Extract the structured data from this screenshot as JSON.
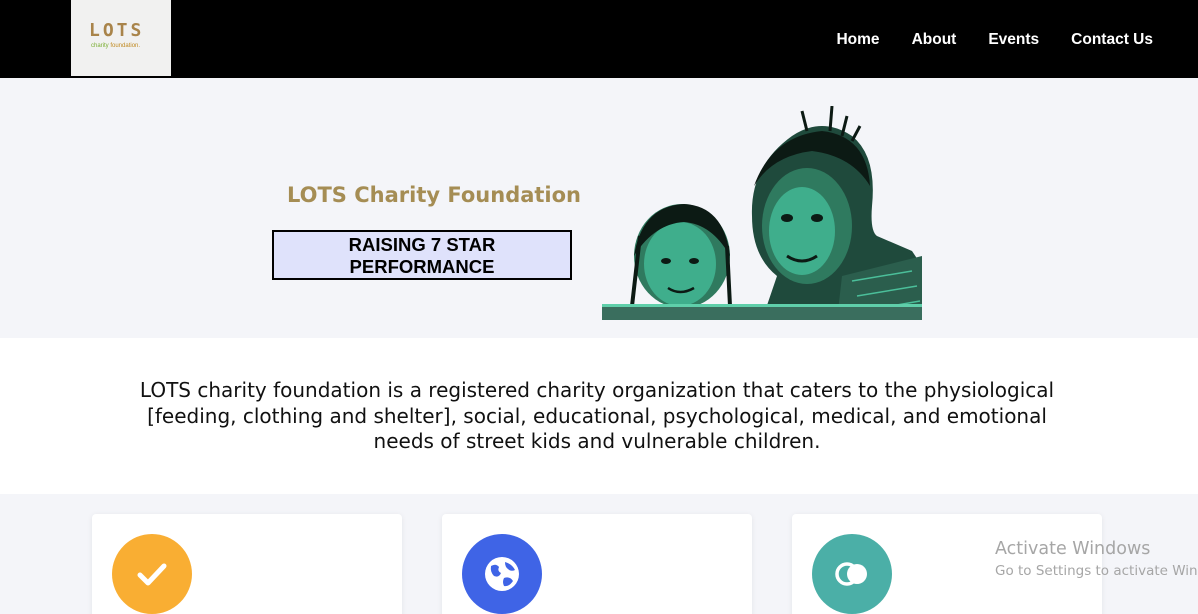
{
  "nav": {
    "logo": {
      "word": "LOTS",
      "sub_a": "charity",
      "sub_b": "foundation."
    },
    "links": [
      "Home",
      "About",
      "Events",
      "Contact Us"
    ]
  },
  "hero": {
    "title": "LOTS Charity Foundation",
    "badge_line1": "RAISING 7 STAR",
    "badge_line2": "PERFORMANCE",
    "image_colors": {
      "tint": "#3fae8c",
      "shadow": "#0c1a14"
    }
  },
  "about": {
    "text": "LOTS charity foundation is a registered charity organization that caters to the physiological [feeding, clothing and shelter], social, educational, psychological, medical, and emotional needs of street kids and vulnerable children."
  },
  "cards": [
    {
      "icon": "check-icon",
      "color": "#f9ae33"
    },
    {
      "icon": "globe-icon",
      "color": "#3f64e6"
    },
    {
      "icon": "rings-icon",
      "color": "#4bafa7"
    }
  ],
  "watermark": {
    "line1": "Activate Windows",
    "line2": "Go to Settings to activate Windows."
  }
}
